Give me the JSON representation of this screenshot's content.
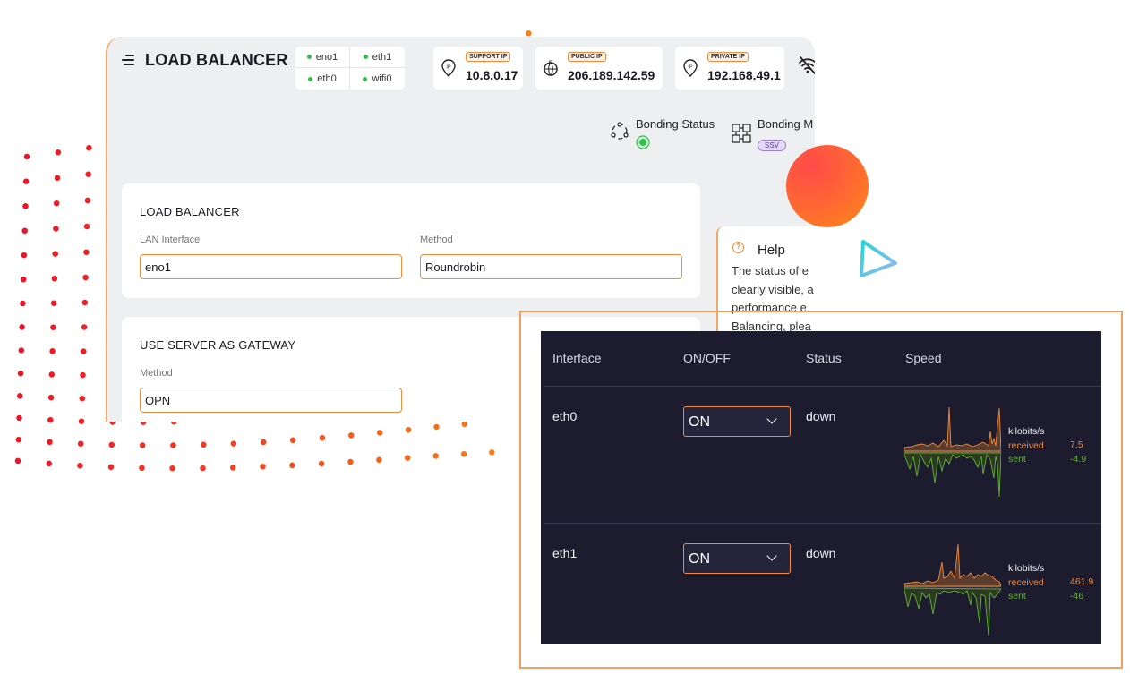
{
  "app": {
    "title": "LOAD BALANCER",
    "interfaces": [
      "eno1",
      "eth1",
      "eth0",
      "wifi0"
    ],
    "ip_cards": [
      {
        "badge": "SUPPORT IP",
        "value": "10.8.0.17"
      },
      {
        "badge": "PUBLIC IP",
        "value": "206.189.142.59"
      },
      {
        "badge": "PRIVATE IP",
        "value": "192.168.49.1"
      }
    ],
    "bonding_status_label": "Bonding Status",
    "bonding_mode_label": "Bonding M",
    "bonding_mode_badge": "SSV"
  },
  "load_balancer_card": {
    "title": "LOAD BALANCER",
    "lan_label": "LAN Interface",
    "lan_value": "eno1",
    "method_label": "Method",
    "method_value": "Roundrobin"
  },
  "gateway_card": {
    "title": "USE SERVER AS GATEWAY",
    "method_label": "Method",
    "method_value": "OPN"
  },
  "help": {
    "title": "Help",
    "text_lines": [
      "The status of e",
      "clearly visible, a",
      "performance e",
      "Balancing, plea"
    ]
  },
  "interface_table": {
    "headers": [
      "Interface",
      "ON/OFF",
      "Status",
      "Speed"
    ],
    "rows": [
      {
        "interface": "eth0",
        "onoff": "ON",
        "status": "down",
        "unit": "kilobits/s",
        "received_label": "received",
        "received": "7.5",
        "sent_label": "sent",
        "sent": "-4.9"
      },
      {
        "interface": "eth1",
        "onoff": "ON",
        "status": "down",
        "unit": "kilobits/s",
        "received_label": "received",
        "received": "461.9",
        "sent_label": "sent",
        "sent": "-46"
      }
    ]
  },
  "colors": {
    "accent": "#f08a3c",
    "status_green": "#2ec24a",
    "sent_green": "#62b233",
    "panel_dark": "#1c1c2e"
  }
}
